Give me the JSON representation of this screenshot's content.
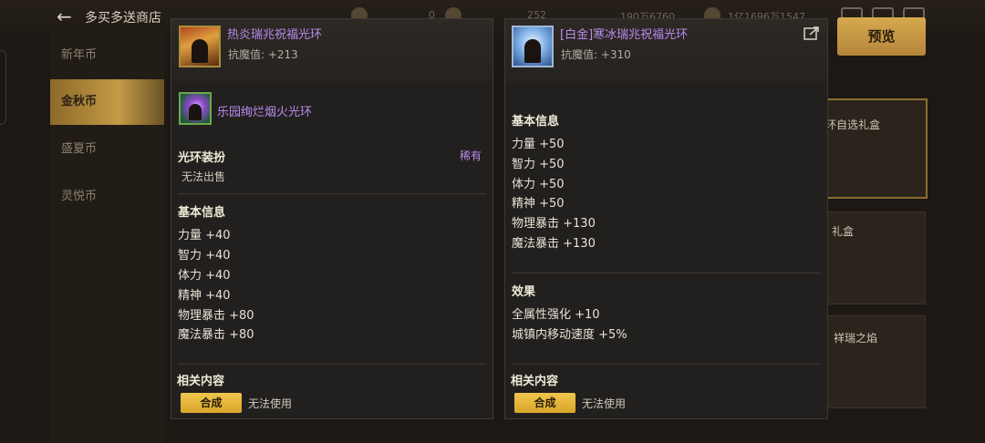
{
  "header": {
    "shop_title": "多买多送商店",
    "res1": "0",
    "res2": "252",
    "res3": "190万6760",
    "res4": "1亿1696万1547"
  },
  "preview_button": "预览",
  "sidebar": {
    "items": [
      {
        "label": "新年币"
      },
      {
        "label": "金秋币"
      },
      {
        "label": "盛夏币"
      },
      {
        "label": "灵悦币"
      }
    ]
  },
  "background": {
    "card1": "环自选礼盒",
    "card2": "礼盒",
    "card3": "祥瑞之焰"
  },
  "left_panel": {
    "title": "热炎瑞兆祝福光环",
    "resist": "抗魔值: +213",
    "sub_item": "乐园绚烂烟火光环",
    "category": "光环装扮",
    "rarity": "稀有",
    "trade": "无法出售",
    "basic_title": "基本信息",
    "stats": [
      "力量 +40",
      "智力 +40",
      "体力 +40",
      "精神 +40",
      "物理暴击 +80",
      "魔法暴击 +80"
    ],
    "related_title": "相关内容",
    "combine": "合成",
    "unusable": "无法使用"
  },
  "right_panel": {
    "title": "[白金]寒冰瑞兆祝福光环",
    "resist": "抗魔值: +310",
    "basic_title": "基本信息",
    "stats": [
      "力量 +50",
      "智力 +50",
      "体力 +50",
      "精神 +50",
      "物理暴击 +130",
      "魔法暴击 +130"
    ],
    "effect_title": "效果",
    "effects": [
      "全属性强化 +10",
      "城镇内移动速度 +5%"
    ],
    "related_title": "相关内容",
    "combine": "合成",
    "unusable": "无法使用"
  },
  "colors": {
    "rarity_purple": "#b88cf0",
    "combine_gold": "#e7b63c",
    "panel_bg": "#22201e"
  }
}
